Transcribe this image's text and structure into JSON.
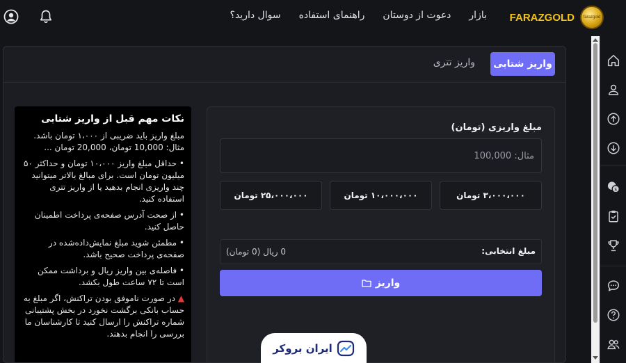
{
  "brand": {
    "name": "FARAZGOLD",
    "coin_text": "farazgold"
  },
  "nav": [
    "بازار",
    "دعوت از دوستان",
    "راهنمای استفاده",
    "سوال دارید؟"
  ],
  "icons": {
    "user": "user-circle-icon",
    "bell": "bell-icon"
  },
  "tabs": {
    "active": "واریز شتابی",
    "other": "واریز تتری"
  },
  "notes": {
    "title": "نکات مهم قبل از واریز شتابی",
    "items": [
      "مبلغ واریز باید ضریبی از ۱،۰۰۰ تومان باشد. مثال: 10,000 تومان، 20,000 تومان ...",
      "• حداقل مبلغ واریز ۱۰،۰۰۰ تومان و حداکثر ۵۰ میلیون تومان است. برای مبالغ بالاتر میتوانید چند واریزی انجام بدهید یا از واریز تتری استفاده کنید.",
      "• از صحت آدرس صفحه‌ی پرداخت اطمینان حاصل کنید.",
      "• مطمئن شوید مبلغ نمایش‌داده‌شده در صفحه‌ی پرداخت صحیح باشد.",
      "• فاصله‌ی بین واریز ریال و برداشت ممکن است تا ۷۲ ساعت طول بکشد.",
      "در صورت ناموفق بودن تراکنش، اگر مبلغ به حساب بانکی برگشت نخورد در بخش پشتیبانی شماره تراکنش را ارسال کنید تا کارشناسان ما بررسی را انجام بدهند."
    ]
  },
  "form": {
    "label": "مبلغ واریزی (تومان)",
    "placeholder": "مثال: 100,000",
    "presets": [
      "۳،۰۰۰،۰۰۰ تومان",
      "۱۰،۰۰۰،۰۰۰ تومان",
      "۲۵،۰۰۰،۰۰۰ تومان"
    ],
    "selected_label": "مبلغ انتخابی:",
    "selected_value": "0 ریال (0 تومان)",
    "submit": "واریز"
  },
  "watermark": "ایران بروکر",
  "colors": {
    "accent": "#6f6cf6",
    "brand": "#f2c318",
    "background": "#141519",
    "panel": "#1c1d22"
  }
}
